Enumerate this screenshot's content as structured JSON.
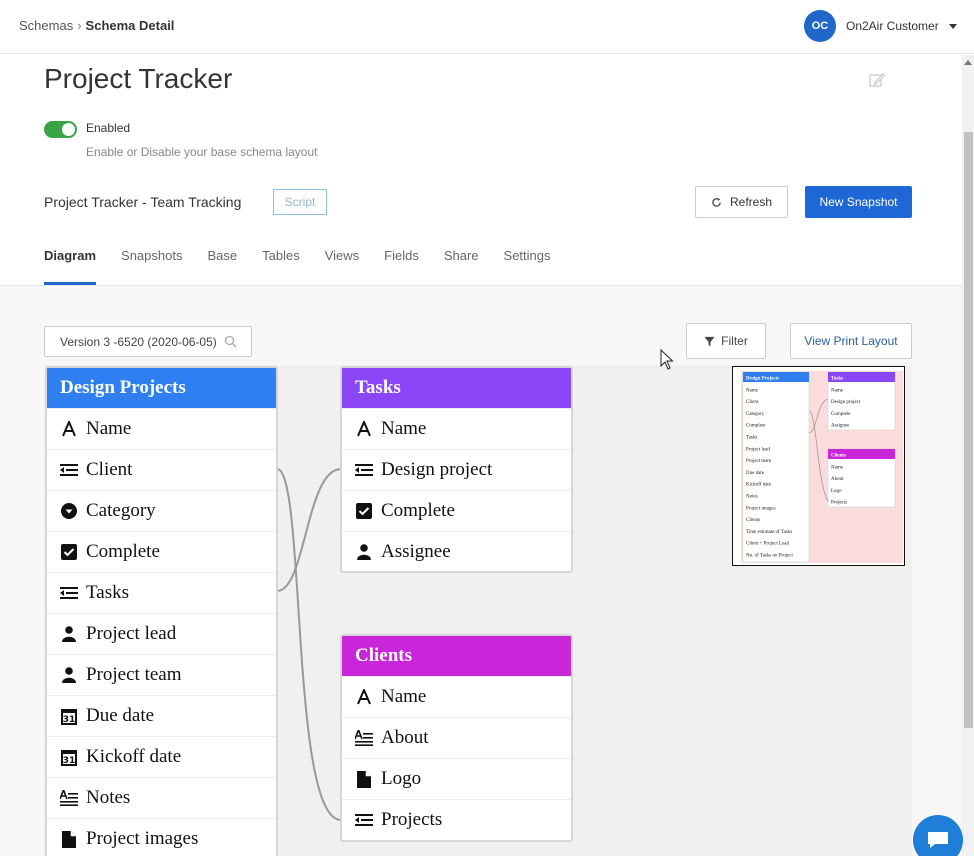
{
  "breadcrumb": {
    "parent": "Schemas",
    "current": "Schema Detail"
  },
  "user": {
    "initials": "OC",
    "name": "On2Air Customer"
  },
  "page": {
    "title": "Project Tracker"
  },
  "toggle": {
    "label": "Enabled",
    "description": "Enable or Disable your base schema layout",
    "on": true
  },
  "base": {
    "name": "Project Tracker - Team Tracking",
    "script_label": "Script"
  },
  "buttons": {
    "refresh": "Refresh",
    "new_snapshot": "New Snapshot",
    "filter": "Filter",
    "print_layout": "View Print Layout"
  },
  "tabs": [
    {
      "label": "Diagram",
      "active": true
    },
    {
      "label": "Snapshots"
    },
    {
      "label": "Base"
    },
    {
      "label": "Tables"
    },
    {
      "label": "Views"
    },
    {
      "label": "Fields"
    },
    {
      "label": "Share"
    },
    {
      "label": "Settings"
    }
  ],
  "version": {
    "value": "Version 3 -6520 (2020-06-05)"
  },
  "colors": {
    "design_projects": "#2f7ff0",
    "tasks": "#8b47f7",
    "clients": "#c925d9",
    "primary": "#1f67d6",
    "toggle_on": "#3aa348"
  },
  "tables": {
    "design_projects": {
      "name": "Design Projects",
      "fields": [
        {
          "name": "Name",
          "icon": "text-icon"
        },
        {
          "name": "Client",
          "icon": "link-icon"
        },
        {
          "name": "Category",
          "icon": "select-icon"
        },
        {
          "name": "Complete",
          "icon": "checkbox-icon"
        },
        {
          "name": "Tasks",
          "icon": "link-icon"
        },
        {
          "name": "Project lead",
          "icon": "user-icon"
        },
        {
          "name": "Project team",
          "icon": "user-icon"
        },
        {
          "name": "Due date",
          "icon": "calendar-icon"
        },
        {
          "name": "Kickoff date",
          "icon": "calendar-icon"
        },
        {
          "name": "Notes",
          "icon": "long-text-icon"
        },
        {
          "name": "Project images",
          "icon": "attachment-icon"
        }
      ]
    },
    "tasks": {
      "name": "Tasks",
      "fields": [
        {
          "name": "Name",
          "icon": "text-icon"
        },
        {
          "name": "Design project",
          "icon": "link-icon"
        },
        {
          "name": "Complete",
          "icon": "checkbox-icon"
        },
        {
          "name": "Assignee",
          "icon": "user-icon"
        }
      ]
    },
    "clients": {
      "name": "Clients",
      "fields": [
        {
          "name": "Name",
          "icon": "text-icon"
        },
        {
          "name": "About",
          "icon": "long-text-icon"
        },
        {
          "name": "Logo",
          "icon": "attachment-icon"
        },
        {
          "name": "Projects",
          "icon": "link-icon"
        }
      ]
    }
  },
  "minimap": {
    "design_projects": [
      "Design Projects",
      "Name",
      "Client",
      "Category",
      "Complete",
      "Tasks",
      "Project lead",
      "Project team",
      "Due date",
      "Kickoff date",
      "Notes",
      "Project images",
      "Clients",
      "Time estimate of Tasks",
      "Client + Project Lead",
      "No. of Tasks on Project"
    ],
    "tasks": [
      "Tasks",
      "Name",
      "Design project",
      "Complete",
      "Assignee"
    ],
    "clients": [
      "Clients",
      "Name",
      "About",
      "Logo",
      "Projects"
    ]
  }
}
